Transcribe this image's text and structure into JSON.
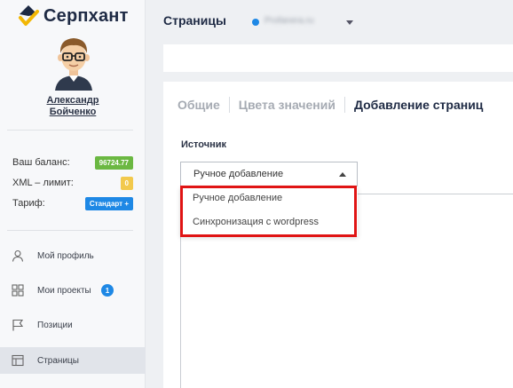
{
  "brand": {
    "name": "Серпхант",
    "colors": {
      "navy": "#1e2a44",
      "accent": "#f2b705"
    }
  },
  "user": {
    "name_line1": "Александр",
    "name_line2": "Бойченко"
  },
  "stats": {
    "balance_label": "Ваш баланс:",
    "balance_value": "96724.77",
    "xml_label": "XML – лимит:",
    "xml_value": "0",
    "tariff_label": "Тариф:",
    "tariff_value": "Стандарт +"
  },
  "nav": {
    "profile": "Мой профиль",
    "projects": "Мои проекты",
    "projects_count": "1",
    "positions": "Позиции",
    "pages": "Страницы"
  },
  "header": {
    "title": "Страницы",
    "site_name": "Profanera.ru"
  },
  "tabs": {
    "general": "Общие",
    "colors": "Цвета значений",
    "add_pages": "Добавление страниц"
  },
  "source": {
    "label": "Источник",
    "selected": "Ручное добавление",
    "options": {
      "manual": "Ручное добавление",
      "wordpress": "Синхронизация с wordpress"
    }
  }
}
